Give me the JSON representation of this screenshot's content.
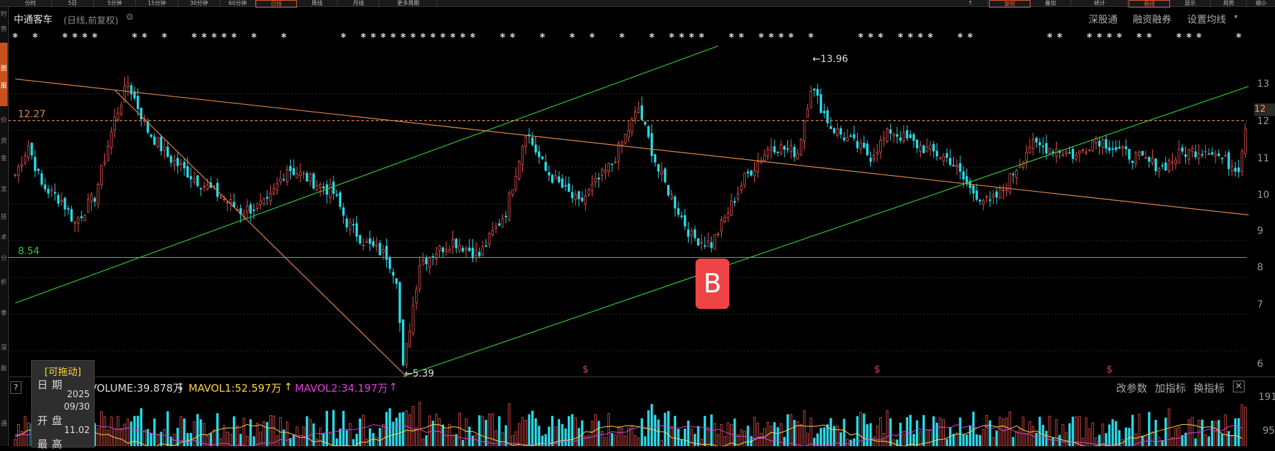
{
  "app": {
    "top_tabs": [
      "分时",
      "5日",
      "5分钟",
      "15分钟",
      "30分钟",
      "60分钟",
      "日线",
      "周线",
      "月线",
      "更多周期"
    ],
    "active_tab": "日线",
    "right_tabs": [
      "↑",
      "复权",
      "叠加",
      "统计",
      "画线",
      "显示",
      "局势",
      "缩小"
    ],
    "active_right": [
      "复权",
      "画线"
    ],
    "left_strip_glyphs": [
      "时",
      "势",
      "图",
      "服",
      "价",
      "资",
      "金",
      "龙",
      "技",
      "术",
      "分",
      "析",
      "季",
      "深",
      "股",
      "通"
    ]
  },
  "header": {
    "stock_name": "中通客车",
    "subtitle": "(日线,前复权)",
    "right_links": [
      "深股通",
      "融资融券",
      "设置均线"
    ]
  },
  "chart_data": {
    "type": "candlestick",
    "ylim": [
      5.3,
      14.5
    ],
    "y_ticks_right": [
      "13",
      "12",
      "11",
      "10",
      "9",
      "8",
      "7",
      "6"
    ],
    "n_bars": 372,
    "close_anchors": [
      [
        0,
        10.8
      ],
      [
        4,
        11.6
      ],
      [
        8,
        10.5
      ],
      [
        14,
        10.1
      ],
      [
        18,
        9.5
      ],
      [
        24,
        10.2
      ],
      [
        30,
        12.3
      ],
      [
        34,
        13.3
      ],
      [
        40,
        12.0
      ],
      [
        46,
        11.3
      ],
      [
        54,
        10.7
      ],
      [
        62,
        10.2
      ],
      [
        68,
        9.8
      ],
      [
        76,
        10.0
      ],
      [
        82,
        11.0
      ],
      [
        90,
        10.6
      ],
      [
        96,
        10.3
      ],
      [
        100,
        9.5
      ],
      [
        106,
        8.9
      ],
      [
        112,
        8.6
      ],
      [
        115,
        8.0
      ],
      [
        117,
        5.5
      ],
      [
        122,
        8.4
      ],
      [
        132,
        9.0
      ],
      [
        140,
        8.6
      ],
      [
        148,
        9.8
      ],
      [
        154,
        12.0
      ],
      [
        160,
        10.9
      ],
      [
        170,
        10.0
      ],
      [
        180,
        11.1
      ],
      [
        188,
        12.6
      ],
      [
        194,
        10.9
      ],
      [
        204,
        9.1
      ],
      [
        210,
        8.9
      ],
      [
        214,
        9.6
      ],
      [
        220,
        10.7
      ],
      [
        228,
        11.6
      ],
      [
        236,
        11.4
      ],
      [
        240,
        13.2
      ],
      [
        246,
        12.1
      ],
      [
        258,
        11.3
      ],
      [
        264,
        12.0
      ],
      [
        272,
        11.6
      ],
      [
        282,
        11.2
      ],
      [
        288,
        10.4
      ],
      [
        294,
        10.0
      ],
      [
        298,
        10.4
      ],
      [
        306,
        11.6
      ],
      [
        314,
        11.5
      ],
      [
        320,
        11.3
      ],
      [
        326,
        11.8
      ],
      [
        334,
        11.4
      ],
      [
        340,
        11.2
      ],
      [
        346,
        11.0
      ],
      [
        352,
        11.4
      ],
      [
        360,
        11.5
      ],
      [
        366,
        11.1
      ],
      [
        369,
        11.0
      ],
      [
        371,
        12.1
      ]
    ],
    "annotations": [
      {
        "label": "12.27",
        "value": 12.27
      },
      {
        "label": "8.54",
        "value": 8.54
      },
      {
        "label": "←13.96",
        "value": 13.96,
        "bar": 240
      },
      {
        "label": "←5.39",
        "value": 5.39,
        "bar": 117
      }
    ],
    "b_signal": {
      "label": "B",
      "bar": 210
    },
    "trendlines": [
      {
        "color": "#32c832",
        "from": [
          0,
          7.3
        ],
        "to": [
          212,
          14.3
        ]
      },
      {
        "color": "#32c832",
        "from": [
          117,
          5.3
        ],
        "to": [
          372,
          13.2
        ]
      },
      {
        "color": "#e0874a",
        "from": [
          0,
          13.4
        ],
        "to": [
          372,
          9.7
        ]
      },
      {
        "color": "#e0874a",
        "from": [
          30,
          13.1
        ],
        "to": [
          118,
          5.3
        ]
      }
    ],
    "dividend_marks": [
      172,
      260,
      330
    ],
    "star_row": "✱ ✱ ✱ ✱ ✱ ✱ ✱ ✱ ✱ ✱ ✱ ✱ ✱ ✱ ✱ ✱ ✱ ✱",
    "volume": {
      "label": "VOLUME",
      "value": "VOLUME:39.878万",
      "ma1": "MAVOL1:52.597万",
      "ma2": "MAVOL2:34.197万",
      "ma1_color": "#ffd54a",
      "ma2_color": "#e040e0",
      "right_ticks": [
        "191",
        "95"
      ]
    },
    "colors": {
      "up": "#e8544f",
      "down": "#29d9e6"
    }
  },
  "side_chip": "12",
  "volume_panel": {
    "question": "?",
    "right_buttons": [
      "改参数",
      "加指标",
      "换指标"
    ],
    "close": "✕"
  },
  "tooltip": {
    "header": "[可拖动]",
    "rows": [
      {
        "label": "日期",
        "value": "2025"
      },
      {
        "label": "",
        "value": "09/30"
      },
      {
        "label": "开盘",
        "value": "11.02"
      },
      {
        "label": "最高",
        "value": ""
      }
    ]
  }
}
